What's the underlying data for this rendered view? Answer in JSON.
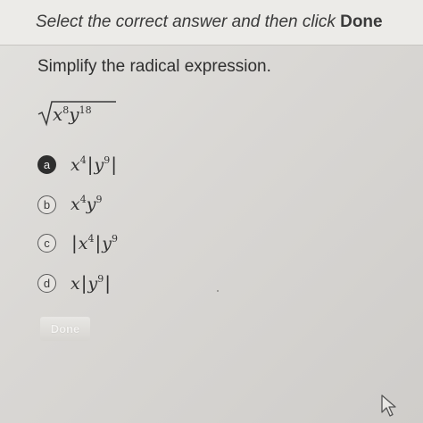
{
  "header": {
    "instruction_prefix": "Select the correct answer and then click ",
    "instruction_bold": "Done"
  },
  "question": {
    "prompt": "Simplify the radical expression.",
    "radicand_base1": "x",
    "radicand_exp1": "8",
    "radicand_base2": "y",
    "radicand_exp2": "18"
  },
  "options": [
    {
      "letter": "a",
      "selected": true,
      "base1": "x",
      "exp1": "4",
      "bar": "|",
      "base2": "y",
      "exp2": "9",
      "bar_close": "|"
    },
    {
      "letter": "b",
      "selected": false,
      "base1": "x",
      "exp1": "4",
      "base2": "y",
      "exp2": "9"
    },
    {
      "letter": "c",
      "selected": false,
      "bar": "|",
      "base1": "x",
      "exp1": "4",
      "bar_close": "|",
      "base2": "y",
      "exp2": "9"
    },
    {
      "letter": "d",
      "selected": false,
      "base1": "x",
      "bar": "|",
      "base2": "y",
      "exp2": "9",
      "bar_close": "|"
    }
  ],
  "actions": {
    "done_label": "Done"
  }
}
